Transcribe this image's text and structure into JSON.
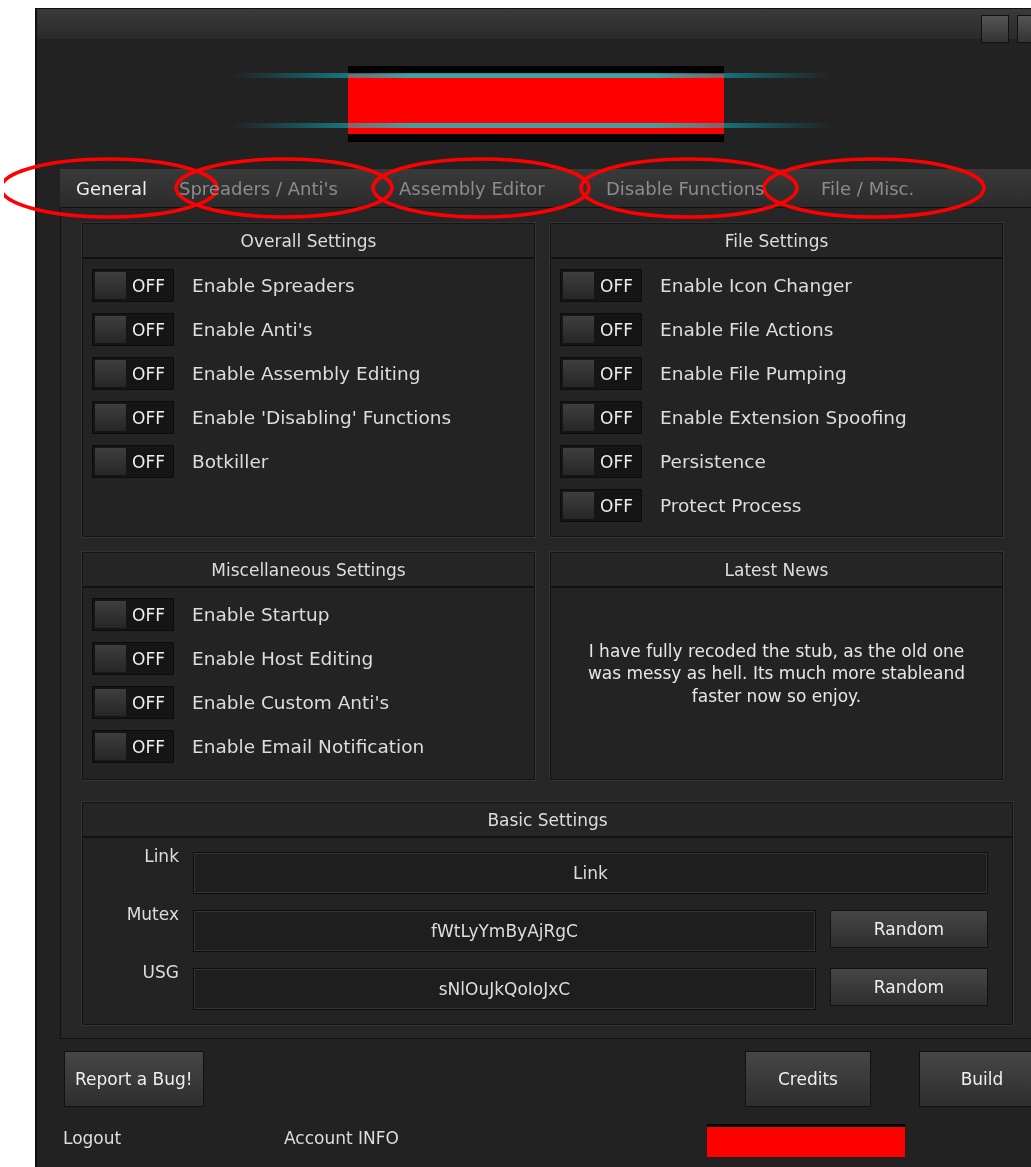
{
  "tabs": [
    {
      "label": "General",
      "selected": true
    },
    {
      "label": "Spreaders / Anti's",
      "selected": false
    },
    {
      "label": "Assembly Editor",
      "selected": false
    },
    {
      "label": "Disable Functions",
      "selected": false
    },
    {
      "label": "File / Misc.",
      "selected": false
    }
  ],
  "panels": [
    {
      "title": "Overall Settings",
      "kind": "toggles",
      "toggles": [
        {
          "label": "Enable Spreaders",
          "on": false,
          "state_text": "OFF"
        },
        {
          "label": "Enable Anti's",
          "on": false,
          "state_text": "OFF"
        },
        {
          "label": "Enable Assembly Editing",
          "on": false,
          "state_text": "OFF"
        },
        {
          "label": "Enable 'Disabling' Functions",
          "on": false,
          "state_text": "OFF"
        },
        {
          "label": "Botkiller",
          "on": false,
          "state_text": "OFF"
        }
      ]
    },
    {
      "title": "File Settings",
      "kind": "toggles",
      "toggles": [
        {
          "label": "Enable Icon Changer",
          "on": false,
          "state_text": "OFF"
        },
        {
          "label": "Enable File Actions",
          "on": false,
          "state_text": "OFF"
        },
        {
          "label": "Enable File Pumping",
          "on": false,
          "state_text": "OFF"
        },
        {
          "label": "Enable Extension Spoofing",
          "on": false,
          "state_text": "OFF"
        },
        {
          "label": "Persistence",
          "on": false,
          "state_text": "OFF"
        },
        {
          "label": "Protect Process",
          "on": false,
          "state_text": "OFF"
        }
      ]
    },
    {
      "title": "Miscellaneous Settings",
      "kind": "toggles",
      "toggles": [
        {
          "label": "Enable Startup",
          "on": false,
          "state_text": "OFF"
        },
        {
          "label": "Enable Host Editing",
          "on": false,
          "state_text": "OFF"
        },
        {
          "label": "Enable Custom Anti's",
          "on": false,
          "state_text": "OFF"
        },
        {
          "label": "Enable Email Notification",
          "on": false,
          "state_text": "OFF"
        }
      ]
    },
    {
      "title": "Latest News",
      "kind": "news",
      "text": "I have fully recoded the stub, as the old one was messy as hell. Its much more stableand faster now so enjoy."
    }
  ],
  "basic_settings": {
    "title": "Basic Settings",
    "fields": [
      {
        "label": "Link",
        "value": "Link"
      },
      {
        "label": "Mutex",
        "value": "fWtLyYmByAjRgC",
        "button": "Random"
      },
      {
        "label": "USG",
        "value": "sNlOuJkQoIoJxC",
        "button": "Random"
      }
    ]
  },
  "footer": {
    "left_button": "Report a Bug!",
    "right_buttons": [
      "Credits",
      "Build"
    ],
    "links": [
      "Logout",
      "Account INFO"
    ]
  }
}
